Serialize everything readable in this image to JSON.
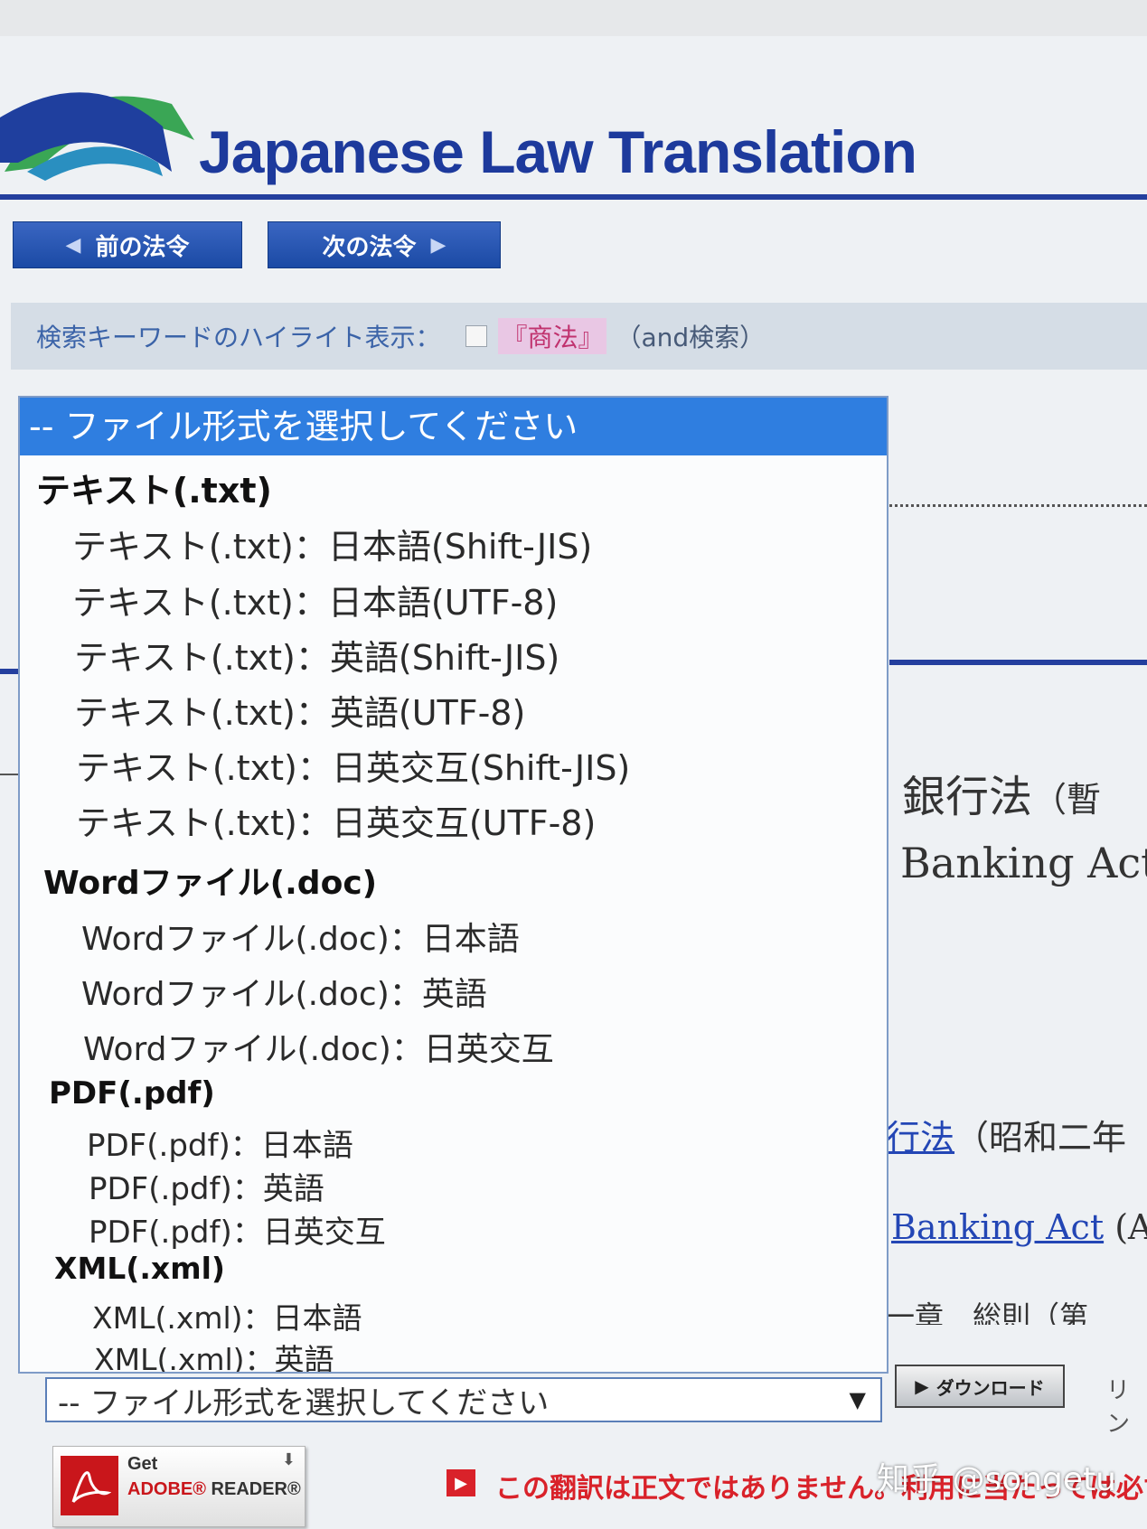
{
  "header": {
    "site_title": "Japanese Law Translation"
  },
  "nav": {
    "prev_label": "前の法令",
    "next_label": "次の法令"
  },
  "highlight": {
    "label": "検索キーワードのハイライト表示：",
    "keyword": "『商法』",
    "note": "（and検索）",
    "checked": false
  },
  "dropdown": {
    "selected_label": "-- ファイル形式を選択してください",
    "groups": [
      {
        "label": "テキスト(.txt)",
        "options": [
          "テキスト(.txt)：日本語(Shift-JIS)",
          "テキスト(.txt)：日本語(UTF-8)",
          "テキスト(.txt)：英語(Shift-JIS)",
          "テキスト(.txt)：英語(UTF-8)",
          "テキスト(.txt)：日英交互(Shift-JIS)",
          "テキスト(.txt)：日英交互(UTF-8)"
        ]
      },
      {
        "label": "Wordファイル(.doc)",
        "options": [
          "Wordファイル(.doc)：日本語",
          "Wordファイル(.doc)：英語",
          "Wordファイル(.doc)：日英交互"
        ]
      },
      {
        "label": "PDF(.pdf)",
        "options": [
          "PDF(.pdf)：日本語",
          "PDF(.pdf)：英語",
          "PDF(.pdf)：日英交互"
        ]
      },
      {
        "label": "XML(.xml)",
        "options": [
          "XML(.xml)：日本語",
          "XML(.xml)：英語"
        ]
      }
    ]
  },
  "select_box": {
    "value": "-- ファイル形式を選択してください",
    "arrow_icon": "triangle-down-icon"
  },
  "content": {
    "law_title_ja": "銀行法",
    "law_title_ja_paren": "（暫",
    "law_title_en": "Banking Act",
    "link_ja_text": "行法",
    "link_ja_rest": "（昭和二年",
    "link_en_text": "Banking Act",
    "link_en_rest": " (Ac",
    "chapter_text": "一章　総則（第",
    "download_label": "ダウンロード",
    "link_partial": "リン"
  },
  "footer": {
    "adobe_get": "Get",
    "adobe_brand": "ADOBE®",
    "adobe_reader": "READER®",
    "notice": "この翻訳は正文ではありません。利用に当たっては必ず正文を"
  },
  "watermark": "知乎 @songetu",
  "colors": {
    "brand_blue": "#1d3a9c",
    "selected_blue": "#2f7ee0",
    "notice_red": "#d9222a",
    "keyword_pink": "#c0326e"
  }
}
